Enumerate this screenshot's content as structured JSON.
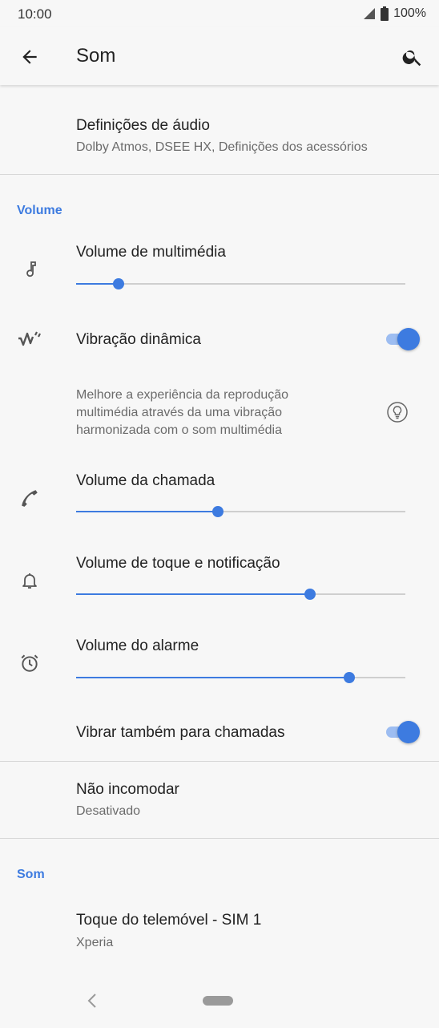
{
  "status_bar": {
    "time": "10:00",
    "battery": "100%"
  },
  "app_bar": {
    "title": "Som"
  },
  "audio_settings": {
    "title": "Definições de áudio",
    "subtitle": "Dolby Atmos, DSEE HX, Definições dos acessórios"
  },
  "volume_section": {
    "header": "Volume",
    "media": {
      "label": "Volume de multimédia",
      "level": 0.13
    },
    "dynamic_vibration": {
      "label": "Vibração dinâmica",
      "enabled": true,
      "description": "Melhore a experiência da reprodução multimédia através da uma vibração harmonizada com o som multimédia"
    },
    "call": {
      "label": "Volume da chamada",
      "level": 0.43
    },
    "ring": {
      "label": "Volume de toque e notificação",
      "level": 0.71
    },
    "alarm": {
      "label": "Volume do alarme",
      "level": 0.83
    },
    "vibrate_calls": {
      "label": "Vibrar também para chamadas",
      "enabled": true
    }
  },
  "dnd": {
    "title": "Não incomodar",
    "subtitle": "Desativado"
  },
  "sound_section": {
    "header": "Som",
    "ringtone": {
      "title": "Toque do telemóvel - SIM 1",
      "subtitle": "Xperia"
    }
  },
  "colors": {
    "accent": "#3d7be0",
    "background": "#f7f7f7"
  },
  "icons": [
    "signal-icon",
    "battery-icon",
    "back-arrow-icon",
    "search-icon",
    "music-note-icon",
    "dynamic-vibration-icon",
    "lightbulb-icon",
    "phone-icon",
    "bell-icon",
    "alarm-clock-icon"
  ]
}
